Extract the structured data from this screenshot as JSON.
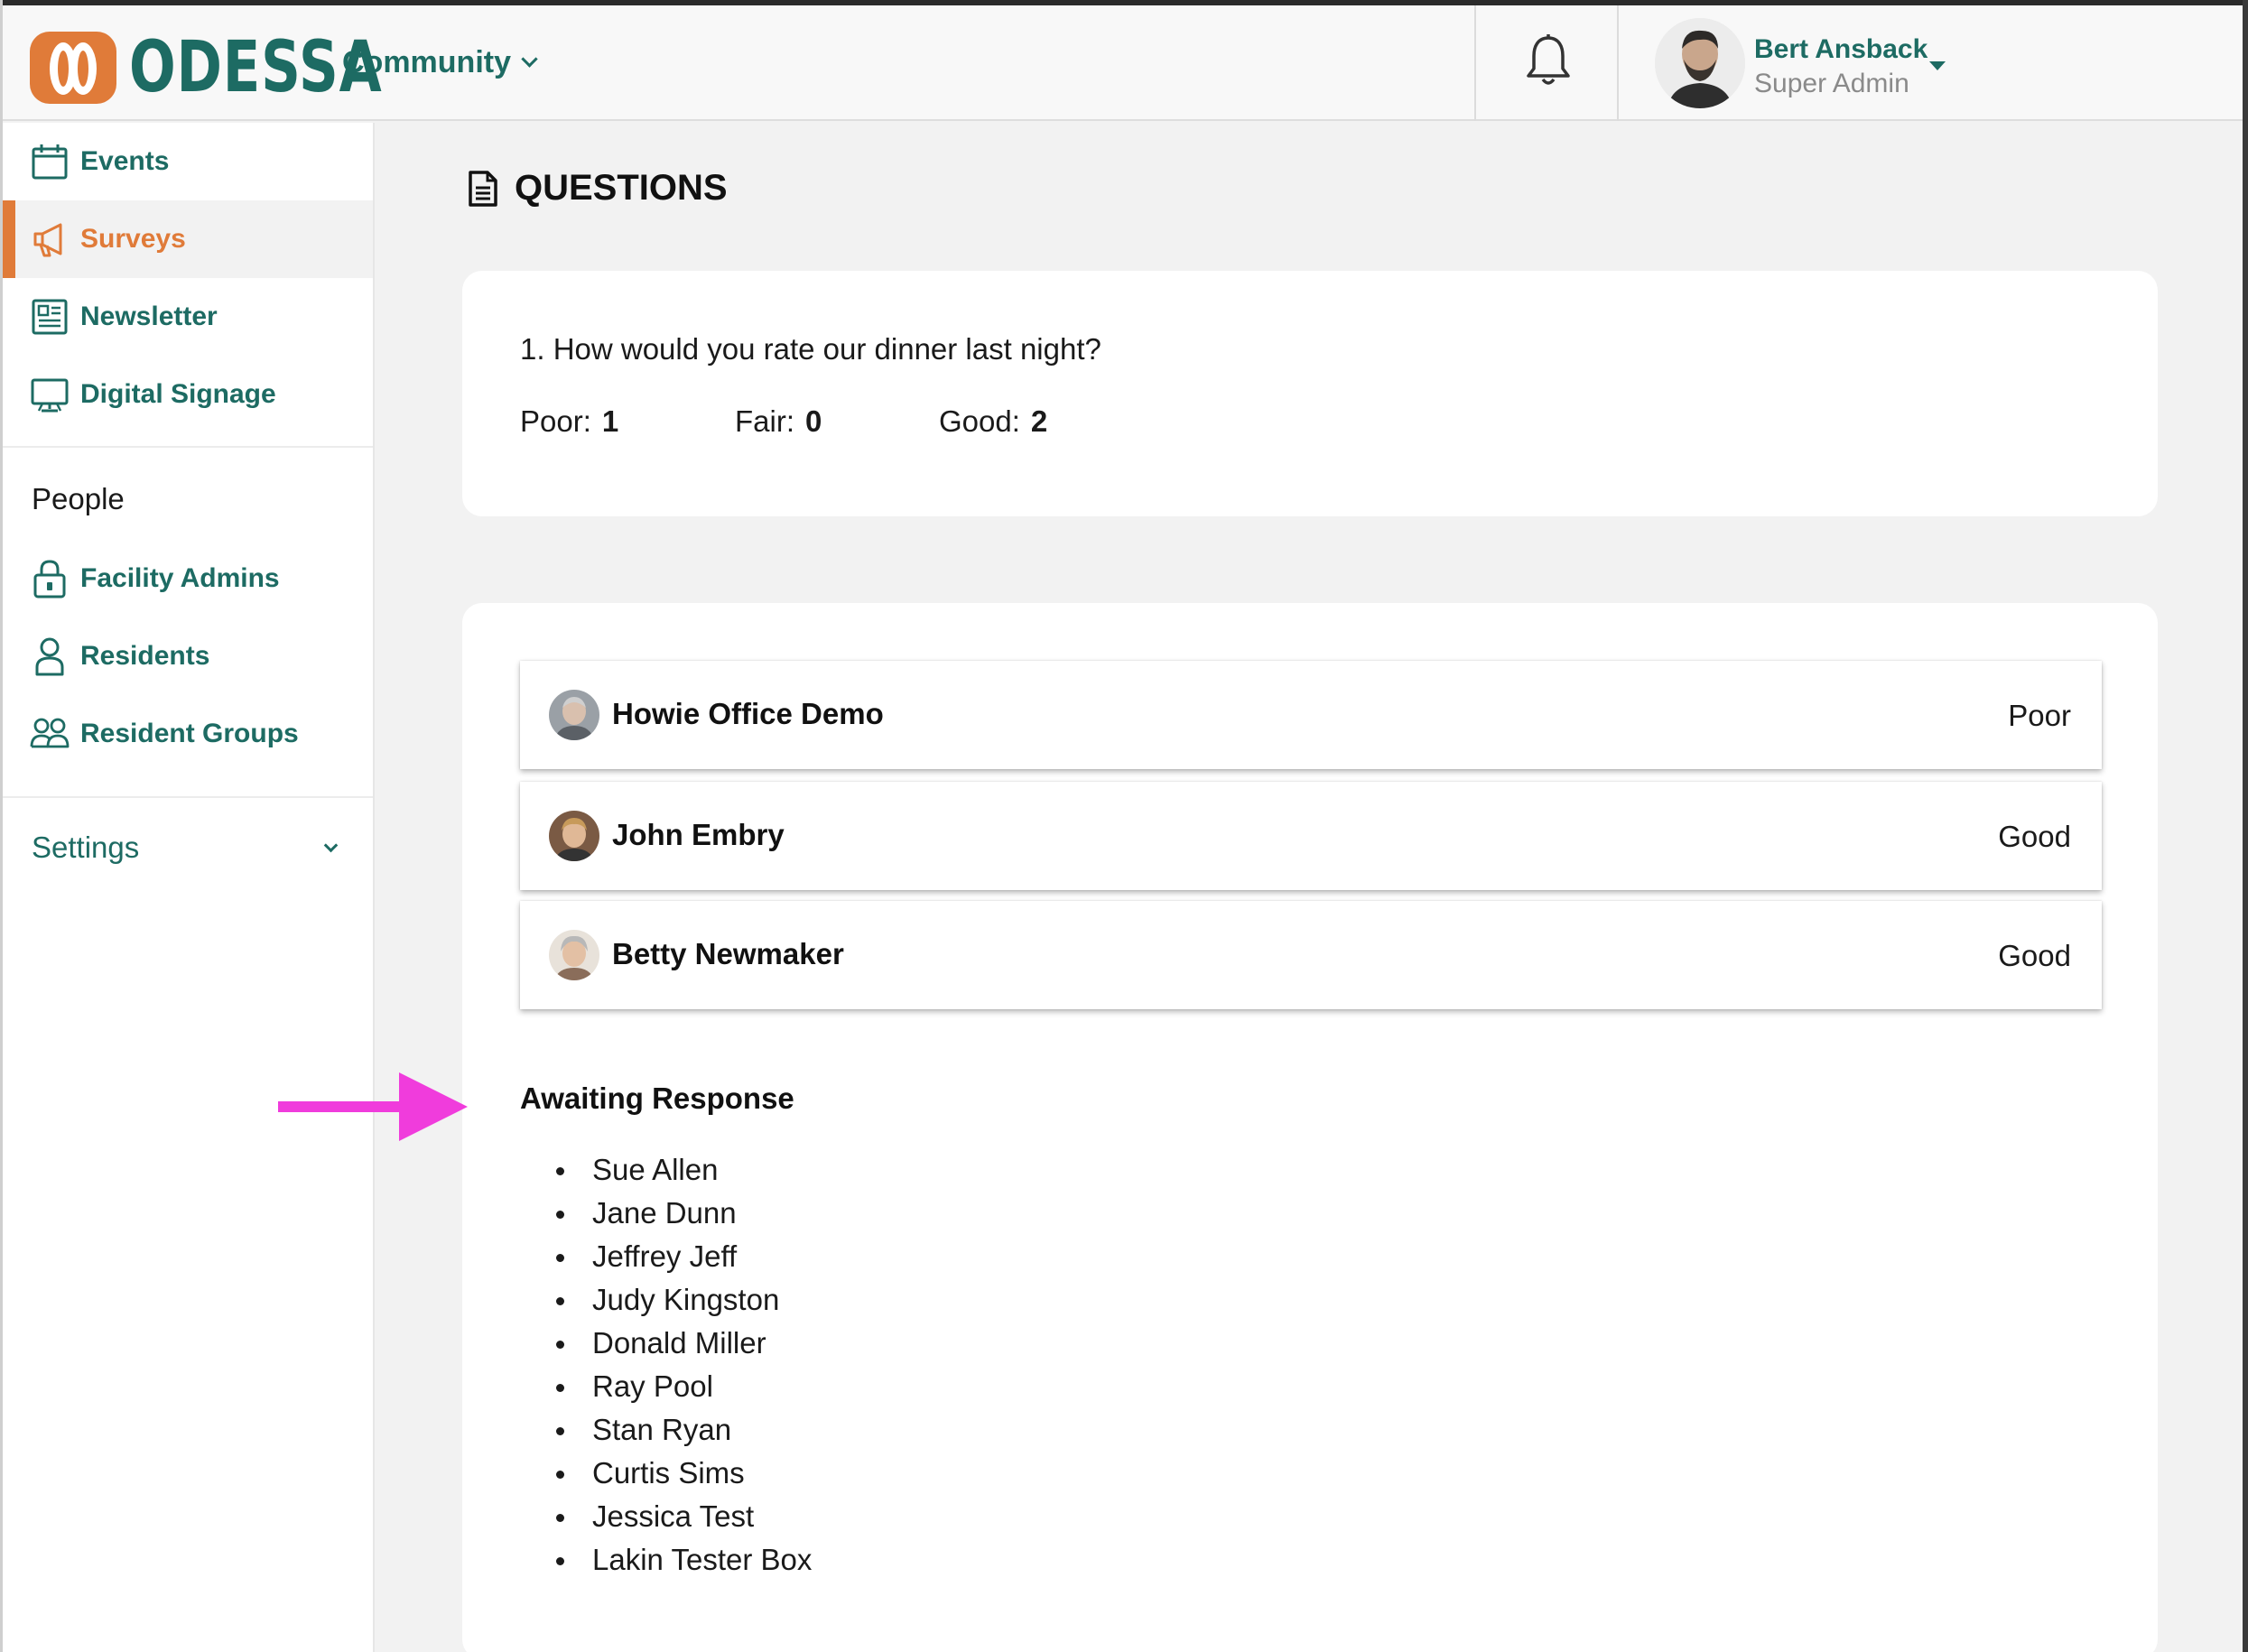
{
  "header": {
    "logo_text": "ODESSA",
    "community_label": "Community",
    "user": {
      "name": "Bert Ansback",
      "role": "Super Admin"
    }
  },
  "sidebar": {
    "items": [
      {
        "label": "Events",
        "icon": "calendar-icon"
      },
      {
        "label": "Surveys",
        "icon": "megaphone-icon",
        "active": true
      },
      {
        "label": "Newsletter",
        "icon": "newsletter-icon"
      },
      {
        "label": "Digital Signage",
        "icon": "monitor-icon"
      }
    ],
    "people_heading": "People",
    "people_items": [
      {
        "label": "Facility Admins",
        "icon": "lock-icon"
      },
      {
        "label": "Residents",
        "icon": "person-icon"
      },
      {
        "label": "Resident Groups",
        "icon": "group-icon"
      }
    ],
    "settings_label": "Settings"
  },
  "main": {
    "title": "QUESTIONS",
    "question": {
      "text": "1. How would you rate our dinner last night?",
      "stats": [
        {
          "label": "Poor:",
          "count": "1"
        },
        {
          "label": "Fair:",
          "count": "0"
        },
        {
          "label": "Good:",
          "count": "2"
        }
      ]
    },
    "responses": [
      {
        "name": "Howie Office Demo",
        "answer": "Poor"
      },
      {
        "name": "John Embry",
        "answer": "Good"
      },
      {
        "name": "Betty Newmaker",
        "answer": "Good"
      }
    ],
    "awaiting_heading": "Awaiting Response",
    "awaiting": [
      "Sue Allen",
      "Jane Dunn",
      "Jeffrey Jeff",
      "Judy Kingston",
      "Donald Miller",
      "Ray Pool",
      "Stan Ryan",
      "Curtis Sims",
      "Jessica Test",
      "Lakin Tester Box"
    ]
  },
  "colors": {
    "brand_teal": "#1d6b63",
    "brand_orange": "#e07b39",
    "annotation_arrow": "#f03cdc"
  }
}
